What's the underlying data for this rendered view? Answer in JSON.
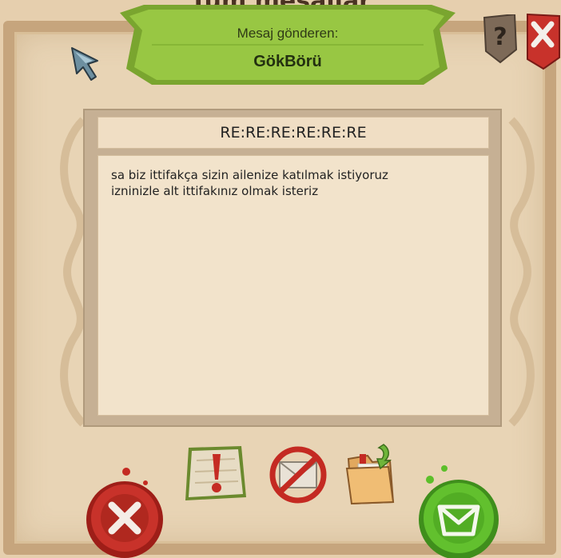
{
  "window": {
    "background_title": "Tüm mesajlar"
  },
  "banner": {
    "subtitle": "Mesaj gönderen:",
    "sender_name": "GökBörü"
  },
  "message": {
    "subject": "RE:RE:RE:RE:RE:RE",
    "body_lines": [
      "sa biz ittifakça sizin ailenize katılmak istiyoruz",
      "izninizle alt ittifakınız olmak isteriz"
    ]
  },
  "buttons": {
    "help": "?",
    "close": "close-icon",
    "delete": "delete-icon",
    "report": "report-icon",
    "block": "block-mail-icon",
    "archive": "archive-folder-icon",
    "reply": "reply-mail-icon"
  },
  "colors": {
    "banner_green": "#8fbf3a",
    "delete_red": "#c42a22",
    "reply_green": "#5cbf2a",
    "parchment": "#e8d4b5"
  }
}
